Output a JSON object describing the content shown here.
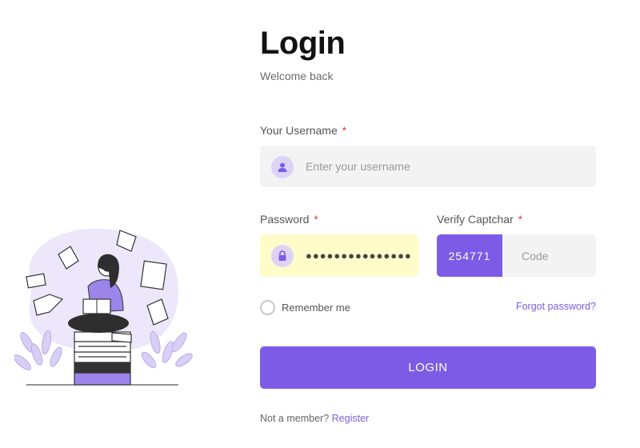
{
  "header": {
    "title": "Login",
    "subtitle": "Welcome back"
  },
  "username": {
    "label": "Your Username",
    "required_mark": "*",
    "placeholder": "Enter your username",
    "icon": "user-icon"
  },
  "password": {
    "label": "Password",
    "required_mark": "*",
    "masked_value": "●●●●●●●●●●●●●●●",
    "icon": "lock-icon"
  },
  "captcha": {
    "label": "Verify Captchar",
    "required_mark": "*",
    "code": "254771",
    "placeholder": "Code"
  },
  "remember": {
    "label": "Remember me",
    "checked": false
  },
  "forgot": {
    "label": "Forgot password?"
  },
  "login_button": {
    "label": "LOGIN"
  },
  "footer": {
    "prompt": "Not a member?",
    "link": "Register"
  },
  "colors": {
    "accent": "#7c5ce6",
    "accent_light": "#ddd3f7",
    "field_bg": "#f3f3f3",
    "autofill_bg": "#fefcc9",
    "required": "#e53935"
  }
}
